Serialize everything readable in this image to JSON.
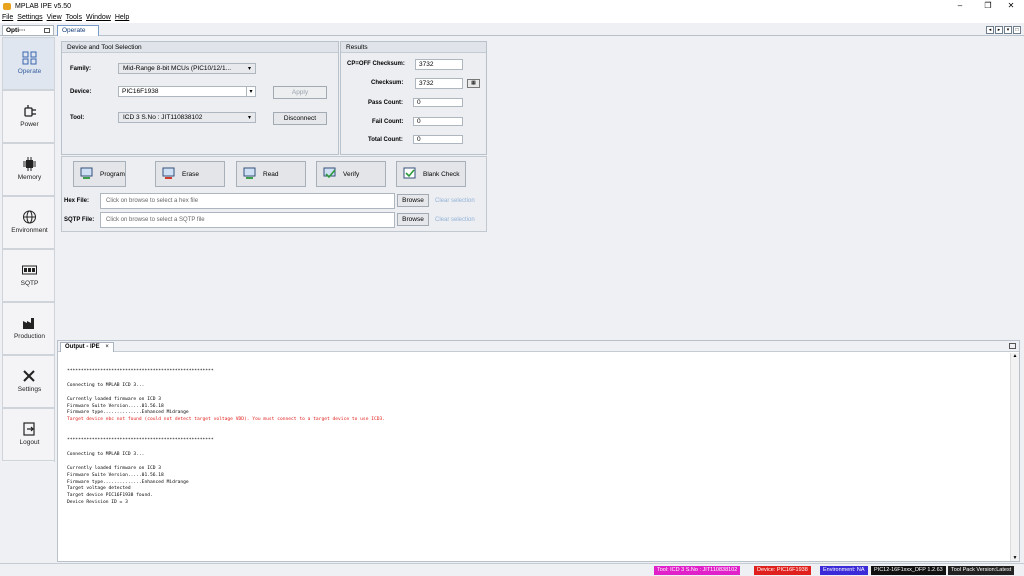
{
  "window": {
    "title": "MPLAB IPE v5.50",
    "controls": [
      "–",
      "❐",
      "✕"
    ]
  },
  "menu": [
    "File",
    "Settings",
    "View",
    "Tools",
    "Window",
    "Help"
  ],
  "tabs": {
    "options": "Opti···",
    "operate": "Operate"
  },
  "sidebar": [
    {
      "label": "Operate",
      "icon": "grid-icon"
    },
    {
      "label": "Power",
      "icon": "plug-icon"
    },
    {
      "label": "Memory",
      "icon": "chip-icon"
    },
    {
      "label": "Environment",
      "icon": "globe-icon"
    },
    {
      "label": "SQTP",
      "icon": "serial-icon"
    },
    {
      "label": "Production",
      "icon": "factory-icon"
    },
    {
      "label": "Settings",
      "icon": "tools-icon"
    },
    {
      "label": "Logout",
      "icon": "logout-icon"
    }
  ],
  "device_panel": {
    "title": "Device and Tool Selection",
    "family_label": "Family:",
    "family_value": "Mid-Range 8-bit MCUs (PIC10/12/1...",
    "device_label": "Device:",
    "device_value": "PIC16F1938",
    "apply": "Apply",
    "tool_label": "Tool:",
    "tool_value": "ICD 3 S.No : JIT110838102",
    "disconnect": "Disconnect"
  },
  "results": {
    "title": "Results",
    "cp_off_label": "CP=OFF Checksum:",
    "cp_off_value": "3732",
    "checksum_label": "Checksum:",
    "checksum_value": "3732",
    "pass_label": "Pass Count:",
    "pass_value": "0",
    "fail_label": "Fail Count:",
    "fail_value": "0",
    "total_label": "Total Count:",
    "total_value": "0"
  },
  "actions": [
    "Program",
    "Erase",
    "Read",
    "Verify",
    "Blank Check"
  ],
  "files": {
    "hex_label": "Hex File:",
    "hex_placeholder": "Click on browse to select a hex file",
    "sqtp_label": "SQTP File:",
    "sqtp_placeholder": "Click on browse to select a SQTP file",
    "browse": "Browse",
    "clear": "Clear selection"
  },
  "output": {
    "tab": "Output - IPE",
    "lines": [
      {
        "t": "*****************************************************",
        "err": false
      },
      {
        "t": "",
        "err": false
      },
      {
        "t": "Connecting to MPLAB ICD 3...",
        "err": false
      },
      {
        "t": "",
        "err": false
      },
      {
        "t": "Currently loaded firmware on ICD 3",
        "err": false
      },
      {
        "t": "Firmware Suite Version.....01.56.18",
        "err": false
      },
      {
        "t": "Firmware type..............Enhanced Midrange",
        "err": false
      },
      {
        "t": "Target device ebc not found (could not detect target voltage VDD). You must connect to a target device to use ICD3.",
        "err": true
      },
      {
        "t": "",
        "err": false
      },
      {
        "t": "",
        "err": false
      },
      {
        "t": "*****************************************************",
        "err": false
      },
      {
        "t": "",
        "err": false
      },
      {
        "t": "Connecting to MPLAB ICD 3...",
        "err": false
      },
      {
        "t": "",
        "err": false
      },
      {
        "t": "Currently loaded firmware on ICD 3",
        "err": false
      },
      {
        "t": "Firmware Suite Version.....01.56.18",
        "err": false
      },
      {
        "t": "Firmware type..............Enhanced Midrange",
        "err": false
      },
      {
        "t": "Target voltage detected",
        "err": false
      },
      {
        "t": "Target device PIC16F1938 found.",
        "err": false
      },
      {
        "t": "Device Revision ID = 3",
        "err": false
      }
    ]
  },
  "status": [
    {
      "text": "Tool: ICD 3 S.No : JIT110838102",
      "color": "#e020c8"
    },
    {
      "text": "Device: PIC16F1938",
      "color": "#e0201c"
    },
    {
      "text": "Environment: NA",
      "color": "#3a2ad8"
    },
    {
      "text": "PIC12-16F1xxx_DFP 1.2.63",
      "color": "#111111"
    },
    {
      "text": "Tool Pack Version:Latest",
      "color": "#222222"
    }
  ]
}
